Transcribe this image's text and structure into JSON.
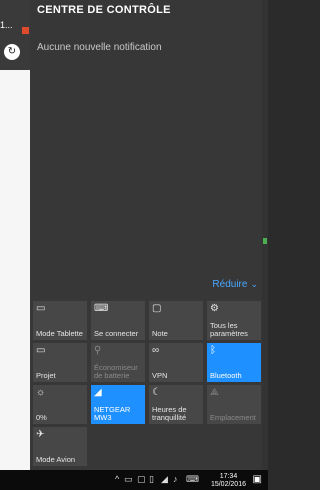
{
  "background": {
    "tab_text": "1...",
    "accent": "#e04b2b",
    "green": "#4caf50"
  },
  "action_center": {
    "title": "CENTRE DE CONTRÔLE",
    "no_notifications": "Aucune nouvelle notification",
    "collapse_label": "Réduire",
    "quick_actions": [
      {
        "label": "Mode Tablette",
        "icon": "tablet-mode-icon",
        "state": "off"
      },
      {
        "label": "Se connecter",
        "icon": "connect-icon",
        "state": "off"
      },
      {
        "label": "Note",
        "icon": "note-icon",
        "state": "off"
      },
      {
        "label": "Tous les paramètres",
        "icon": "settings-icon",
        "state": "off"
      },
      {
        "label": "Projet",
        "icon": "project-icon",
        "state": "off"
      },
      {
        "label": "Économiseur de batterie",
        "icon": "battery-saver-icon",
        "state": "disabled"
      },
      {
        "label": "VPN",
        "icon": "vpn-icon",
        "state": "off"
      },
      {
        "label": "Bluetooth",
        "icon": "bluetooth-icon",
        "state": "on"
      },
      {
        "label": "0%",
        "icon": "brightness-icon",
        "state": "off"
      },
      {
        "label": "NETGEAR MW3",
        "icon": "wifi-icon",
        "state": "on"
      },
      {
        "label": "Heures de tranquillité",
        "icon": "quiet-hours-icon",
        "state": "off"
      },
      {
        "label": "Emplacement",
        "icon": "location-icon",
        "state": "disabled"
      },
      {
        "label": "Mode Avion",
        "icon": "airplane-icon",
        "state": "off"
      }
    ],
    "colors": {
      "on": "#1e90ff",
      "tile": "#474747",
      "link": "#4aa8ff"
    }
  },
  "taskbar": {
    "time": "17:34",
    "date": "15/02/2016"
  }
}
